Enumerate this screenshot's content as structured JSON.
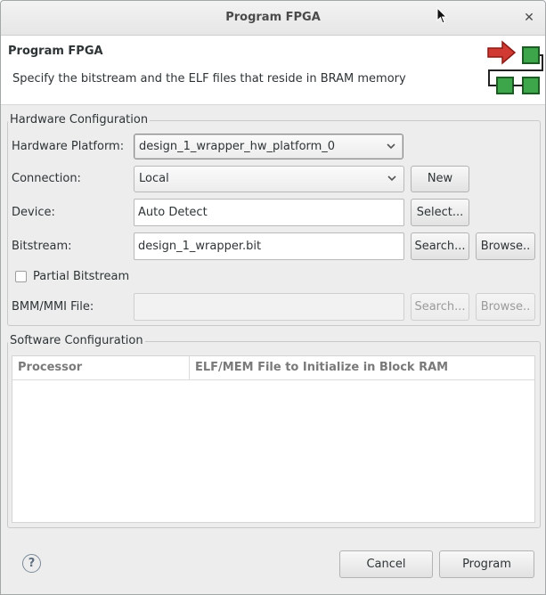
{
  "window": {
    "title": "Program FPGA"
  },
  "banner": {
    "title": "Program FPGA",
    "message": "Specify the bitstream and the ELF files that reside in BRAM memory"
  },
  "hardware": {
    "group_label": "Hardware Configuration",
    "platform_label": "Hardware Platform:",
    "platform_value": "design_1_wrapper_hw_platform_0",
    "connection_label": "Connection:",
    "connection_value": "Local",
    "new_button": "New",
    "device_label": "Device:",
    "device_value": "Auto Detect",
    "select_button": "Select...",
    "bitstream_label": "Bitstream:",
    "bitstream_value": "design_1_wrapper.bit",
    "bitstream_search_button": "Search...",
    "bitstream_browse_button": "Browse..",
    "partial_bitstream_label": "Partial Bitstream",
    "partial_bitstream_checked": false,
    "bmm_label": "BMM/MMI File:",
    "bmm_value": "",
    "bmm_search_button": "Search...",
    "bmm_browse_button": "Browse.."
  },
  "software": {
    "group_label": "Software Configuration",
    "columns": [
      "Processor",
      "ELF/MEM File to Initialize in Block RAM"
    ],
    "rows": []
  },
  "footer": {
    "help_glyph": "?",
    "cancel_button": "Cancel",
    "program_button": "Program"
  },
  "icons": {
    "close": "close-icon",
    "help": "help-icon",
    "banner": "fpga-program-icon"
  }
}
